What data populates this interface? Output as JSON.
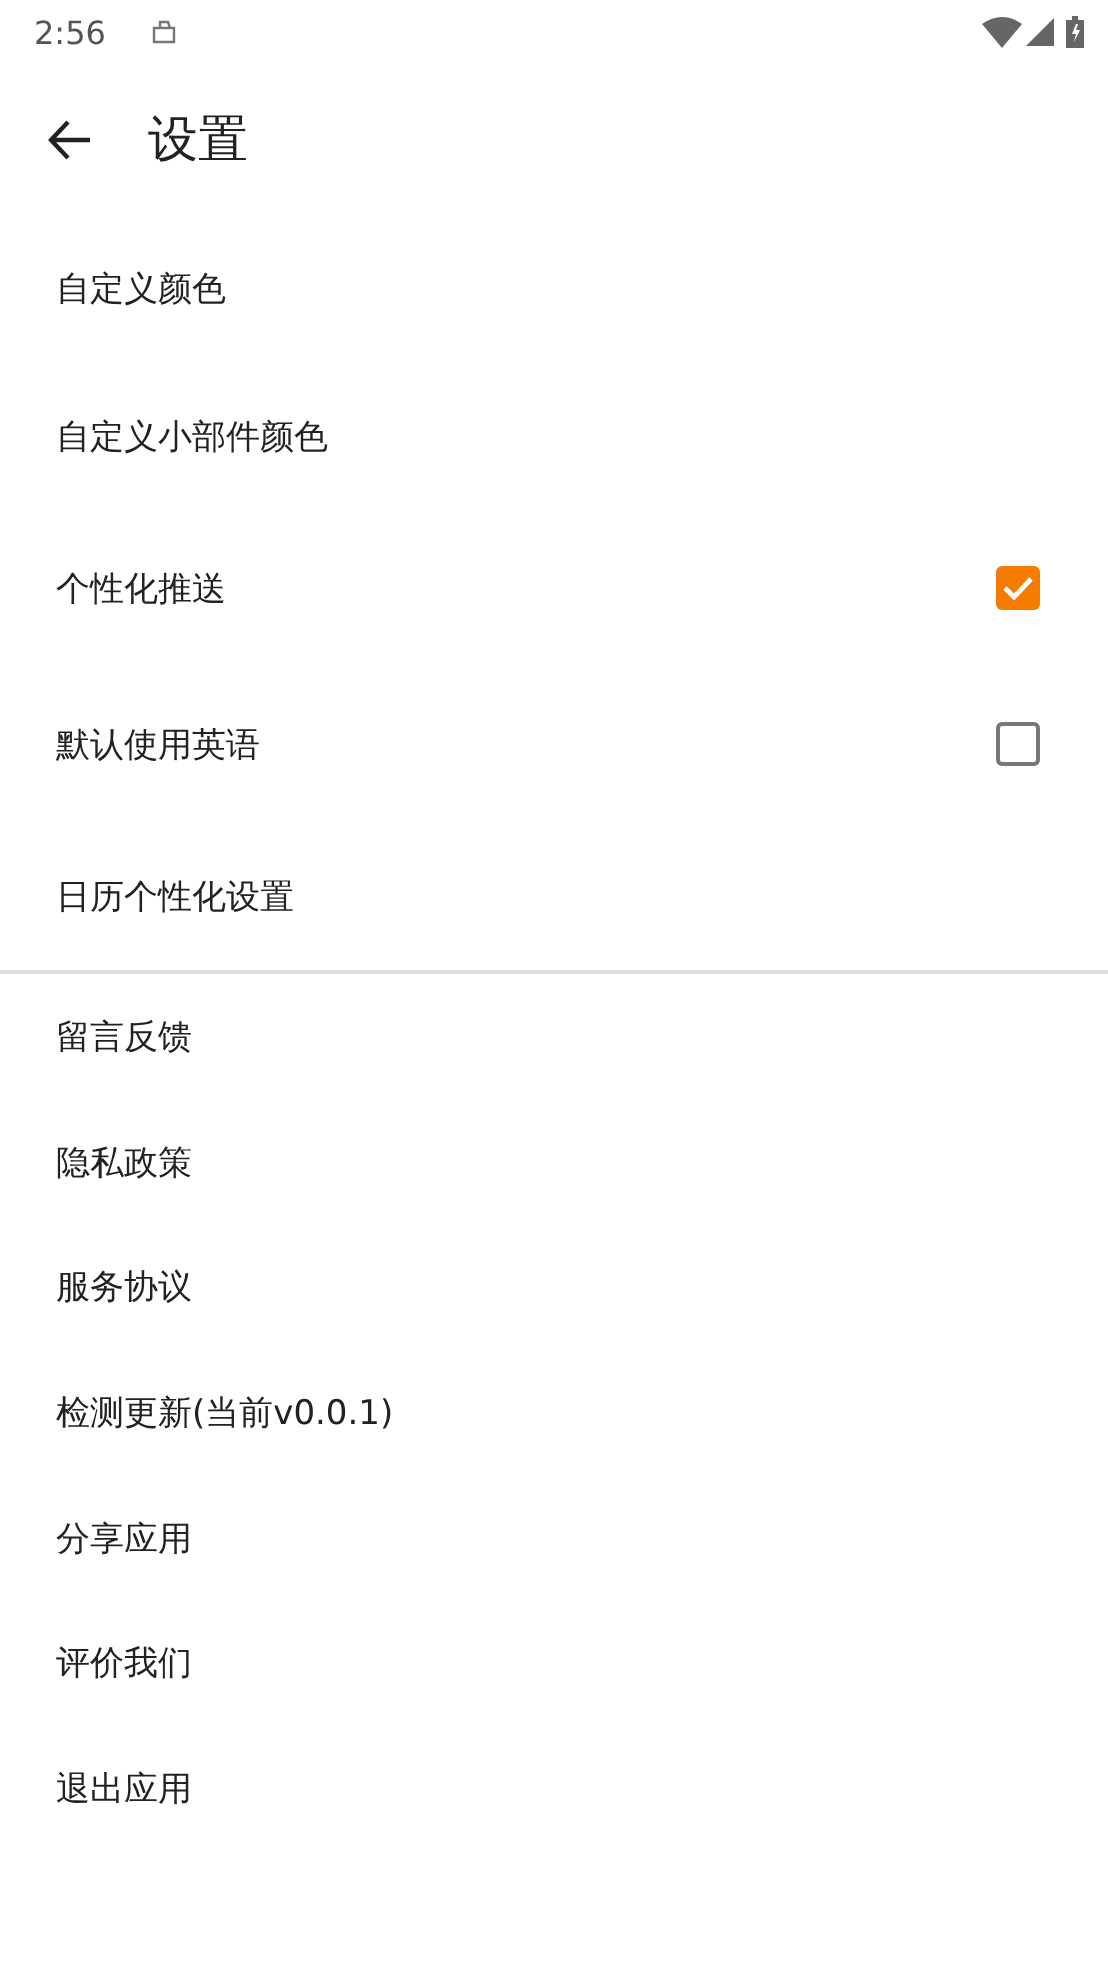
{
  "status_bar": {
    "time": "2:56"
  },
  "toolbar": {
    "title": "设置"
  },
  "sections": [
    {
      "items": [
        {
          "kind": "plain",
          "label": "自定义颜色"
        },
        {
          "kind": "plain",
          "label": "自定义小部件颜色"
        },
        {
          "kind": "checkbox",
          "label": "个性化推送",
          "checked": true
        },
        {
          "kind": "checkbox",
          "label": "默认使用英语",
          "checked": false
        },
        {
          "kind": "plain",
          "label": "日历个性化设置"
        }
      ]
    },
    {
      "items": [
        {
          "kind": "plain",
          "label": "留言反馈"
        },
        {
          "kind": "plain",
          "label": "隐私政策"
        },
        {
          "kind": "plain",
          "label": "服务协议"
        },
        {
          "kind": "plain",
          "label": "检测更新(当前v0.0.1)"
        },
        {
          "kind": "plain",
          "label": "分享应用"
        },
        {
          "kind": "plain",
          "label": "评价我们"
        },
        {
          "kind": "plain",
          "label": "退出应用"
        }
      ]
    }
  ]
}
